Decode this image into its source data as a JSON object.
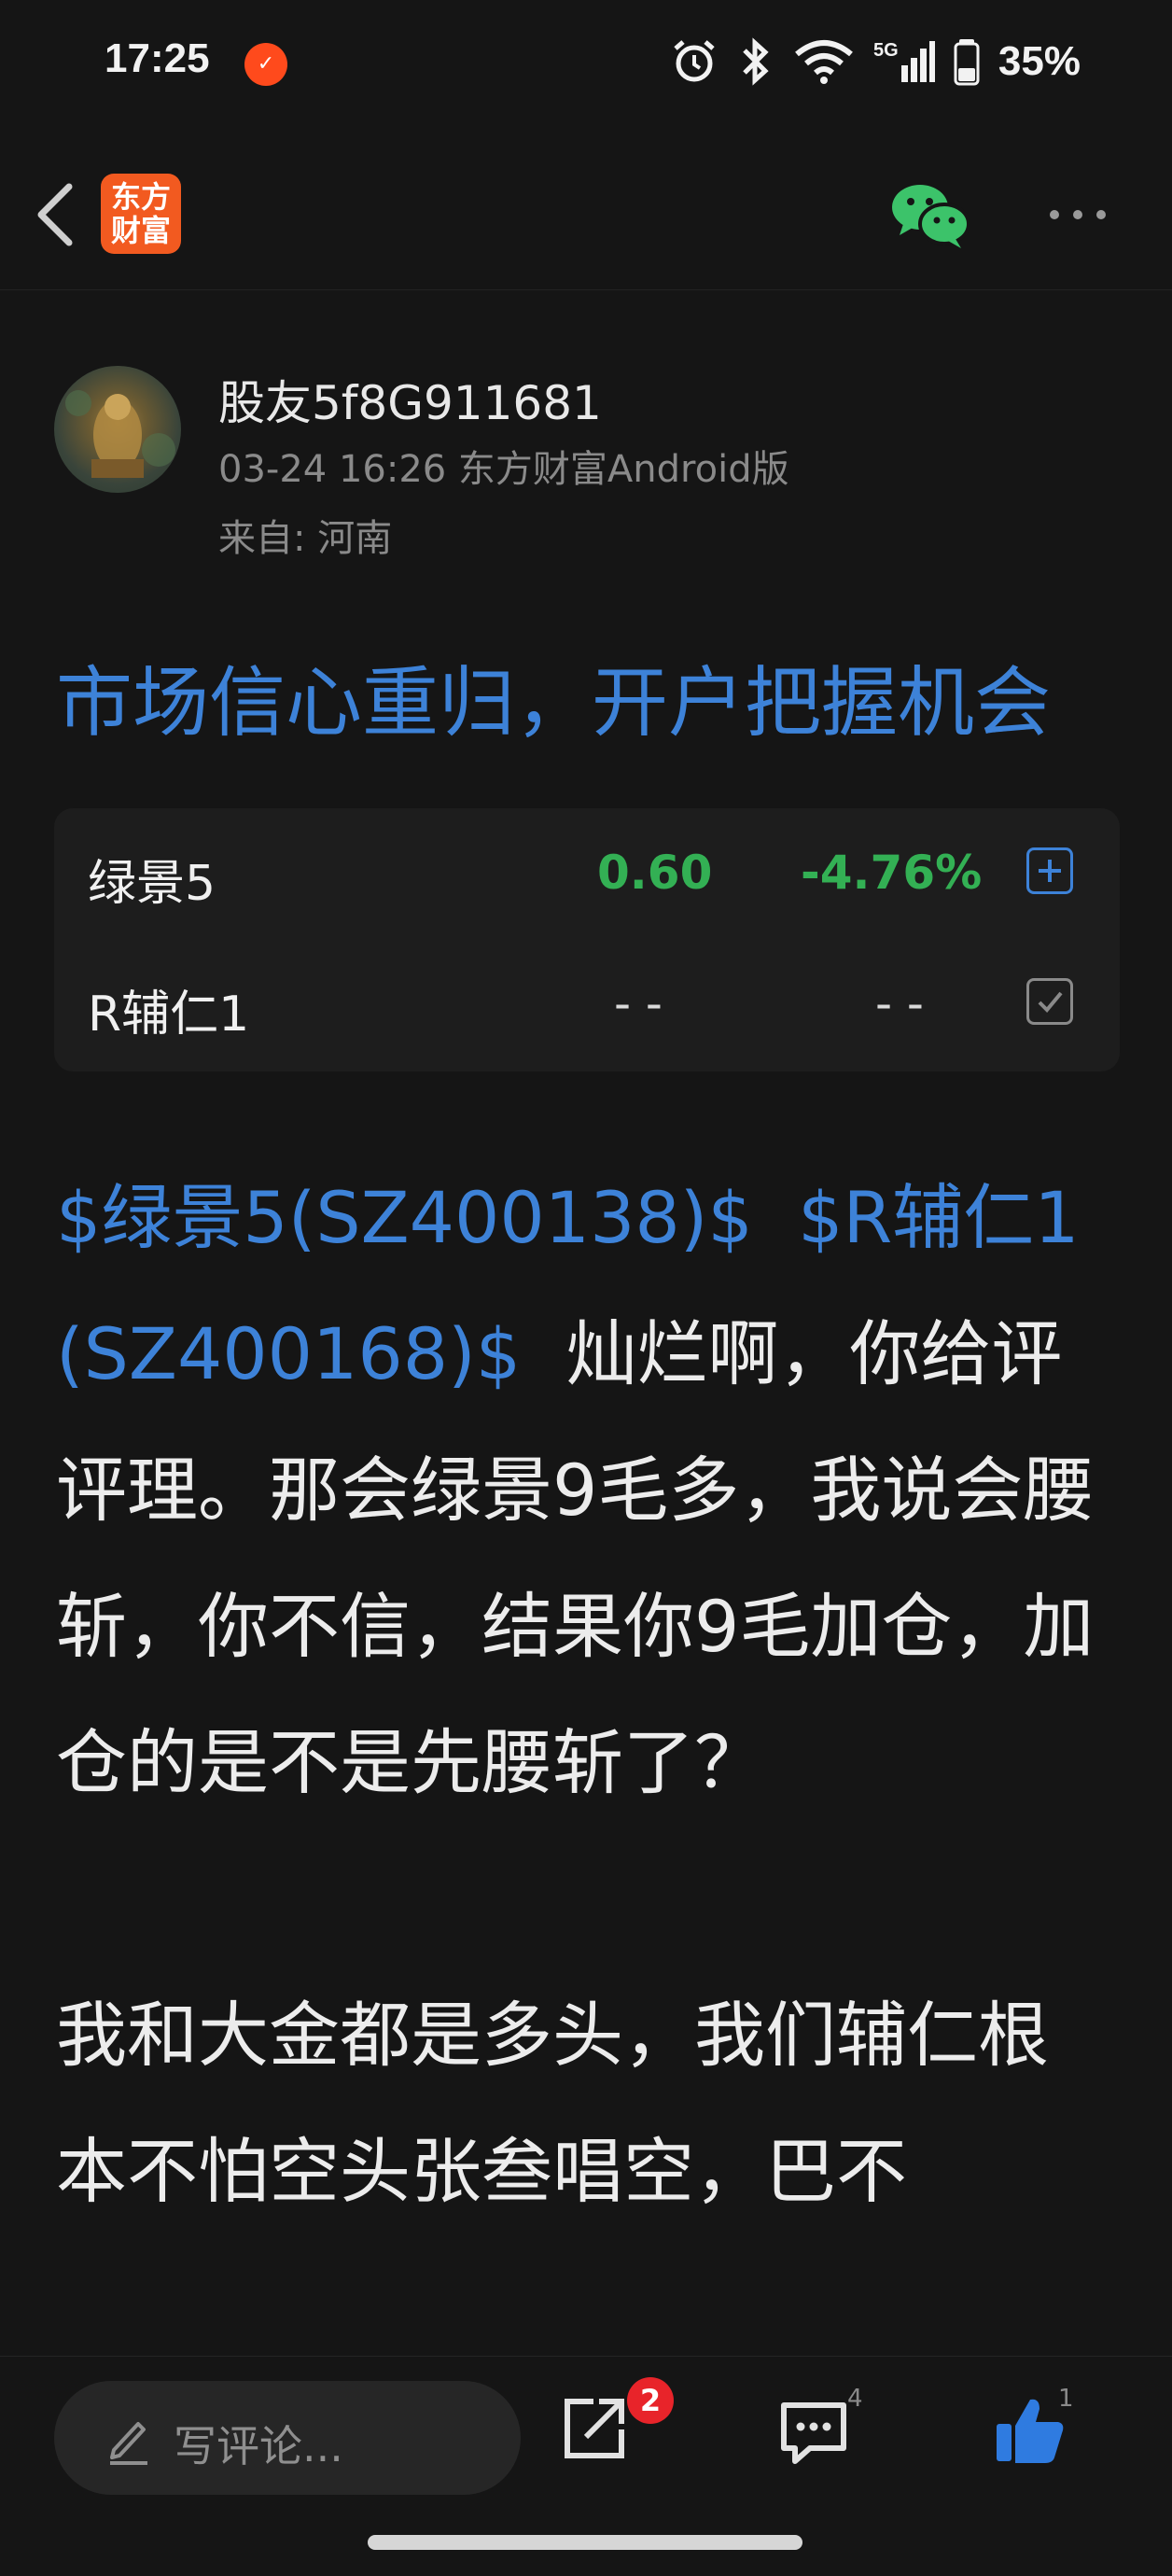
{
  "status_bar": {
    "time": "17:25",
    "notification_icon": "app-notification-icon",
    "battery": "35%",
    "network": "5G",
    "icons": [
      "alarm-icon",
      "bluetooth-icon",
      "wifi-icon",
      "signal-icon",
      "battery-icon"
    ]
  },
  "nav": {
    "logo_line1": "东方",
    "logo_line2": "财富",
    "back_icon": "chevron-left-icon",
    "share_wechat_icon": "wechat-icon",
    "more_icon": "more-icon"
  },
  "author": {
    "name": "股友5f8G911681",
    "meta": "03-24 16:26 东方财富Android版",
    "location": "来自: 河南"
  },
  "post": {
    "title": "市场信心重归，开户把握机会",
    "link1": "$绿景5(SZ400138)$",
    "link2": "$R辅仁1(SZ400168)$",
    "para1_text": "灿烂啊，你给评评理。那会绿景9毛多，我说会腰斩，你不信，结果你9毛加仓，加仓的是不是先腰斩了？",
    "para2_text": "我和大金都是多头，我们辅仁根本不怕空头张叁唱空，巴不"
  },
  "stocks": [
    {
      "name": "绿景5",
      "price": "0.60",
      "change": "-4.76%",
      "action": "add"
    },
    {
      "name": "R辅仁1",
      "price": "- -",
      "change": "- -",
      "action": "checked"
    }
  ],
  "bottom": {
    "comment_placeholder": "写评论...",
    "share_badge": "2",
    "comment_count": "4",
    "like_count": "1"
  },
  "colors": {
    "background": "#151515",
    "link_blue": "#3d82d8",
    "down_green": "#33b054",
    "brand_orange": "#f25a20",
    "badge_red": "#e8242a"
  }
}
